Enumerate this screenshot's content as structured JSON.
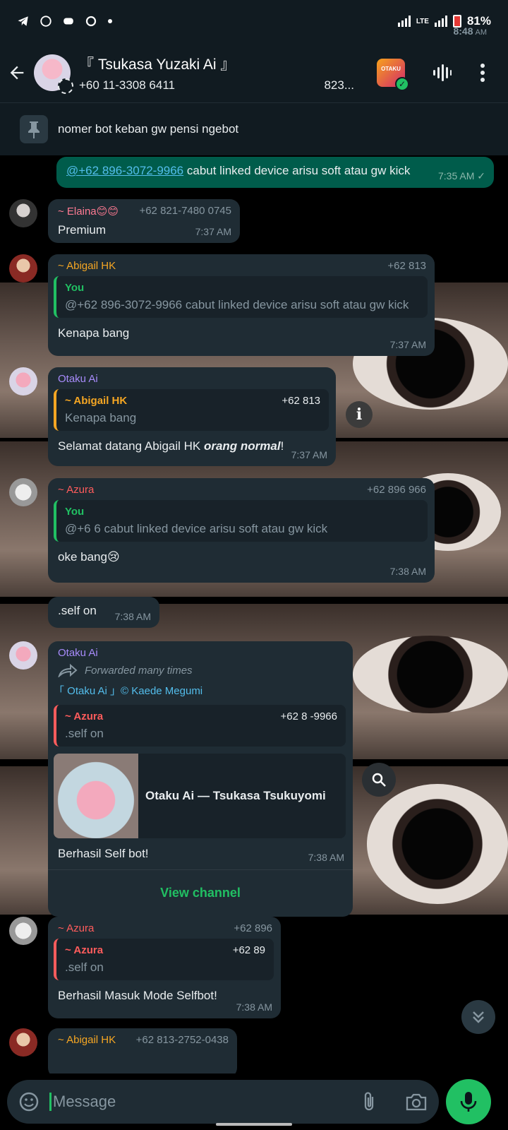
{
  "status_bar": {
    "time": "8:48",
    "ampm": "AM",
    "battery": "81%"
  },
  "header": {
    "title": "『 Tsukasa Yuzaki Ai 』",
    "subtitle_left": "+60 11-3308 6411",
    "subtitle_right": "823...",
    "thumb_label": "OTAKU"
  },
  "pinned": {
    "text": "nomer bot keban gw pensi ngebot"
  },
  "colors": {
    "accent": "#21c063",
    "bubble_in": "#1f2c34",
    "bubble_out": "#005c4b",
    "link": "#53bdeb"
  },
  "messages": [
    {
      "id": "m1",
      "mention": "@+62 896-3072-9966",
      "text": " cabut linked device arisu soft atau gw kick",
      "time": "7:35 AM"
    },
    {
      "id": "m2",
      "sender": "~ Elaina😊😊",
      "phone": "+62 821-7480 0745",
      "text": "Premium",
      "time": "7:37 AM"
    },
    {
      "id": "m3",
      "sender": "~ Abigail HK",
      "phone": "+62 813",
      "quote_name": "You",
      "quote_text": "@+62 896-3072-9966 cabut linked device arisu soft atau gw kick",
      "text": "Kenapa bang",
      "time": "7:37 AM"
    },
    {
      "id": "m4",
      "sender": "Otaku Ai",
      "quote_name": "~ Abigail HK",
      "quote_phone": "+62 813",
      "quote_text": "Kenapa bang",
      "text": "Selamat datang Abigail HK ",
      "text_em": "orang normal",
      "text_end": "!",
      "time": "7:37 AM"
    },
    {
      "id": "m5",
      "sender": "~ Azura",
      "phone": "+62 896  966",
      "quote_name": "You",
      "quote_text": "@+6                    6 cabut linked device arisu soft atau gw kick",
      "text": "oke bang😢",
      "time": "7:38 AM"
    },
    {
      "id": "m6",
      "text": ".self on",
      "time": "7:38 AM"
    },
    {
      "id": "m7",
      "sender": "Otaku Ai",
      "forwarded": "Forwarded many times",
      "channel": "「 Otaku Ai 」© Kaede Megumi",
      "quote_name": "~ Azura",
      "quote_phone": "+62 8    -9966",
      "quote_text": ".self on",
      "preview_title": "Otaku Ai — Tsukasa Tsukuyomi",
      "text": "Berhasil Self bot!",
      "time": "7:38 AM",
      "button": "View channel"
    },
    {
      "id": "m8",
      "sender": "~ Azura",
      "phone": "+62 896",
      "quote_name": "~ Azura",
      "quote_phone": "+62 89",
      "quote_text": ".self on",
      "text": "Berhasil Masuk Mode Selfbot!",
      "time": "7:38 AM"
    },
    {
      "id": "m9",
      "sender": "~ Abigail HK",
      "phone": "+62 813-2752-0438"
    }
  ],
  "input": {
    "placeholder": "Message"
  }
}
